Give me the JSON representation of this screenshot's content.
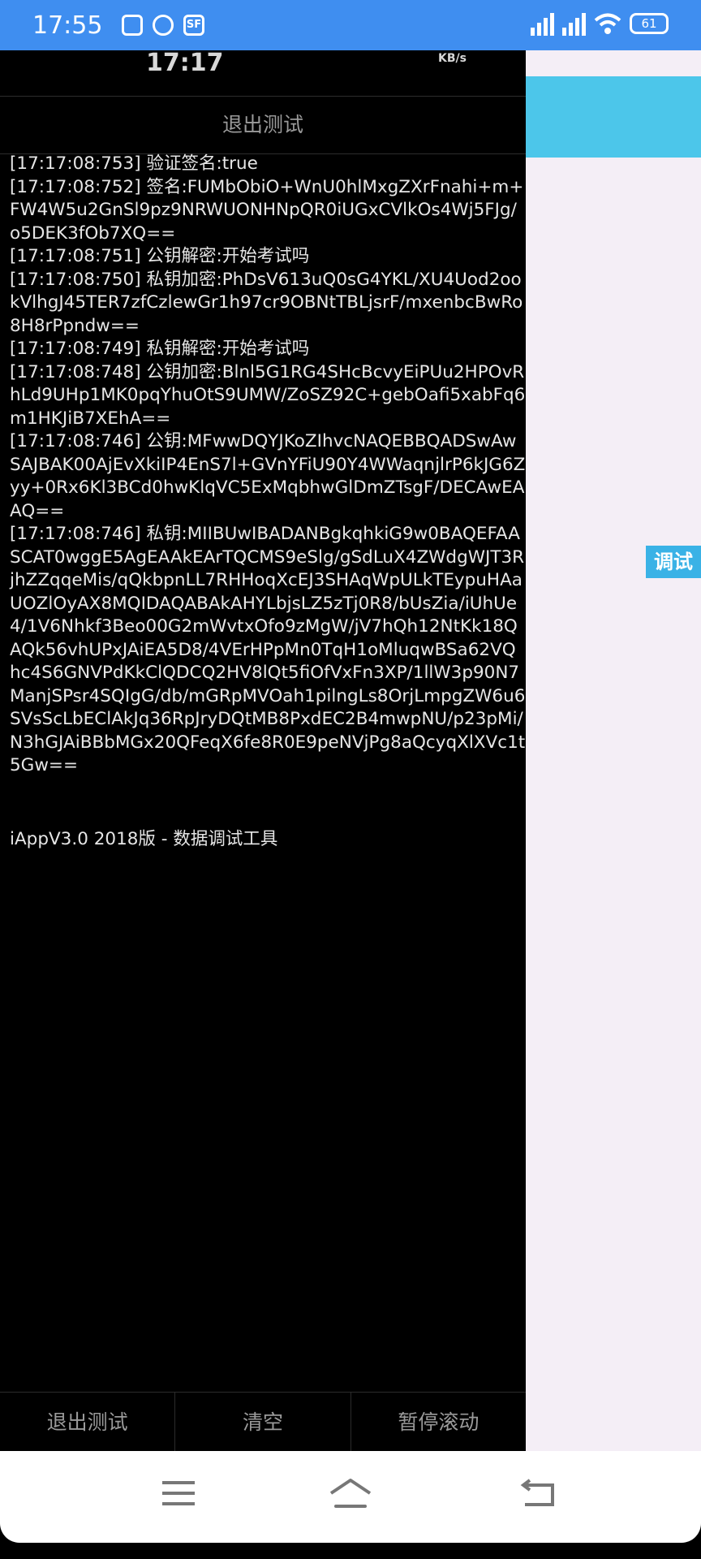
{
  "status_bar": {
    "time": "17:55",
    "left_icons": [
      "notification-icon",
      "alarm-icon",
      "sf-icon"
    ],
    "sf_label": "SF",
    "battery": "61"
  },
  "ghost_overlay": {
    "time": "17:17",
    "speed_unit": "KB/s"
  },
  "top_header": {
    "label": "退出测试"
  },
  "log_lines": [
    "[17:17:08:753]  验证签名:true",
    "[17:17:08:752]  签名:FUMbObiO+WnU0hlMxgZXrFnahi+m+FW4W5u2GnSl9pz9NRWUONHNpQR0iUGxCVlkOs4Wj5FJg/o5DEK3fOb7XQ==",
    "[17:17:08:751]  公钥解密:开始考试吗",
    "[17:17:08:750]  私钥加密:PhDsV613uQ0sG4YKL/XU4Uod2ookVlhgJ45TER7zfCzlewGr1h97cr9OBNtTBLjsrF/mxenbcBwRo8H8rPpndw==",
    "[17:17:08:749]  私钥解密:开始考试吗",
    "[17:17:08:748]  公钥加密:Blnl5G1RG4SHcBcvyEiPUu2HPOvRhLd9UHp1MK0pqYhuOtS9UMW/ZoSZ92C+gebOafi5xabFq6m1HKJiB7XEhA==",
    "[17:17:08:746]  公钥:MFwwDQYJKoZIhvcNAQEBBQADSwAwSAJBAK00AjEvXkiIP4EnS7l+GVnYFiU90Y4WWaqnjlrP6kJG6Zyy+0Rx6Kl3BCd0hwKlqVC5ExMqbhwGlDmZTsgF/DECAwEAAQ==",
    "[17:17:08:746]  私钥:MIIBUwIBADANBgkqhkiG9w0BAQEFAASCAT0wggE5AgEAAkEArTQCMS9eSlg/gSdLuX4ZWdgWJT3RjhZZqqeMis/qQkbpnLL7RHHoqXcEJ3SHAqWpULkTEypuHAaUOZlOyAX8MQIDAQABAkAHYLbjsLZ5zTj0R8/bUsZia/iUhUe4/1V6Nhkf3Beo00G2mWvtxOfo9zMgW/jV7hQh12NtKk18QAQk56vhUPxJAiEA5D8/4VErHPpMn0TqH1oMluqwBSa62VQhc4S6GNVPdKkClQDCQ2HV8lQt5fiOfVxFn3XP/1llW3p90N7ManjSPsr4SQIgG/db/mGRpMVOah1pilngLs8OrjLmpgZW6u6SVsScLbEClAkJq36RpJryDQtMB8PxdEC2B4mwpNU/p23pMi/N3hGJAiBBbMGx20QFeqX6fe8R0E9peNVjPg8aQcyqXlXVc1t5Gw=="
  ],
  "footer_title": "iAppV3.0 2018版 - 数据调试工具",
  "bottom_bar": {
    "exit_label": "退出测试",
    "clear_label": "清空",
    "pause_label": "暂停滚动"
  },
  "right_panel": {
    "debug_tab_label": "调试"
  },
  "nav": [
    "menu-icon",
    "home-icon",
    "back-icon"
  ],
  "colors": {
    "status_bar": "#3f8ef0",
    "log_bg": "#000000",
    "log_text": "#e6e6e6",
    "header_text": "#9a9a9a",
    "right_bg": "#f4eef6",
    "right_header": "#4cc6ea",
    "debug_tab": "#3ab2e6"
  }
}
